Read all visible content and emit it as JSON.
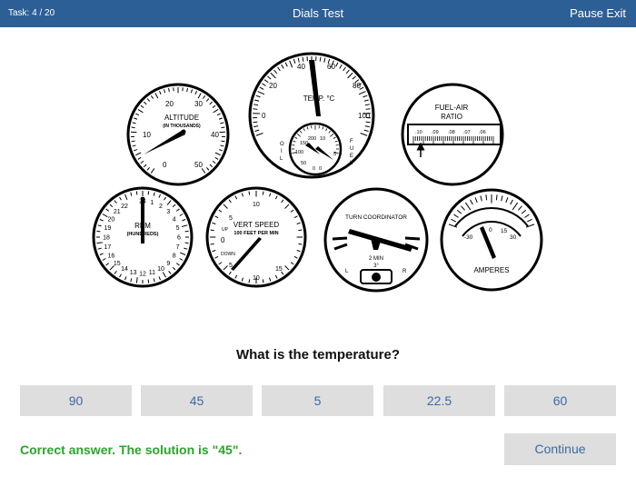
{
  "header": {
    "task": "Task: 4 / 20",
    "title": "Dials Test",
    "pause": "Pause",
    "exit": "Exit"
  },
  "gauges": {
    "altitude": {
      "label1": "ALTITUDE",
      "label2": "(IN THOUSANDS)",
      "ticks": [
        "20",
        "30",
        "10",
        "40",
        "0",
        "50"
      ]
    },
    "temp": {
      "label": "TEMP. °C",
      "ticks": [
        "40",
        "60",
        "20",
        "80",
        "0",
        "100"
      ],
      "oil": "OIL",
      "fuel": "FUEL",
      "sub": [
        "200",
        "150",
        "10",
        "100",
        "5",
        "50",
        "0",
        "0"
      ]
    },
    "fuel_air": {
      "label1": "FUEL-AIR",
      "label2": "RATIO",
      "ticks": [
        ".10",
        ".09",
        ".08",
        ".07",
        ".06"
      ]
    },
    "rpm": {
      "label1": "RPM",
      "label2": "(HUNDREDS)",
      "ticks": [
        "24",
        "1",
        "2",
        "3",
        "4",
        "22",
        "21",
        "5",
        "20",
        "6",
        "19",
        "7",
        "18",
        "8",
        "17",
        "16",
        "9",
        "15",
        "10",
        "14",
        "13",
        "12",
        "11"
      ]
    },
    "vert_speed": {
      "label1": "VERT SPEED",
      "label2": "100 FEET PER MIN",
      "ticks": [
        "10",
        "5",
        "UP",
        "0",
        "DOWN",
        "5",
        "15",
        "10"
      ]
    },
    "turn": {
      "label": "TURN COORDINATOR",
      "min": "2 MIN",
      "deg": "3°",
      "left": "L",
      "right": "R"
    },
    "amperes": {
      "label": "AMPERES",
      "ticks": [
        "-30",
        "0",
        "15",
        "30"
      ]
    }
  },
  "question": "What is the temperature?",
  "answers": [
    "90",
    "45",
    "5",
    "22.5",
    "60"
  ],
  "feedback": "Correct answer. The solution is \"45\".",
  "continue": "Continue"
}
